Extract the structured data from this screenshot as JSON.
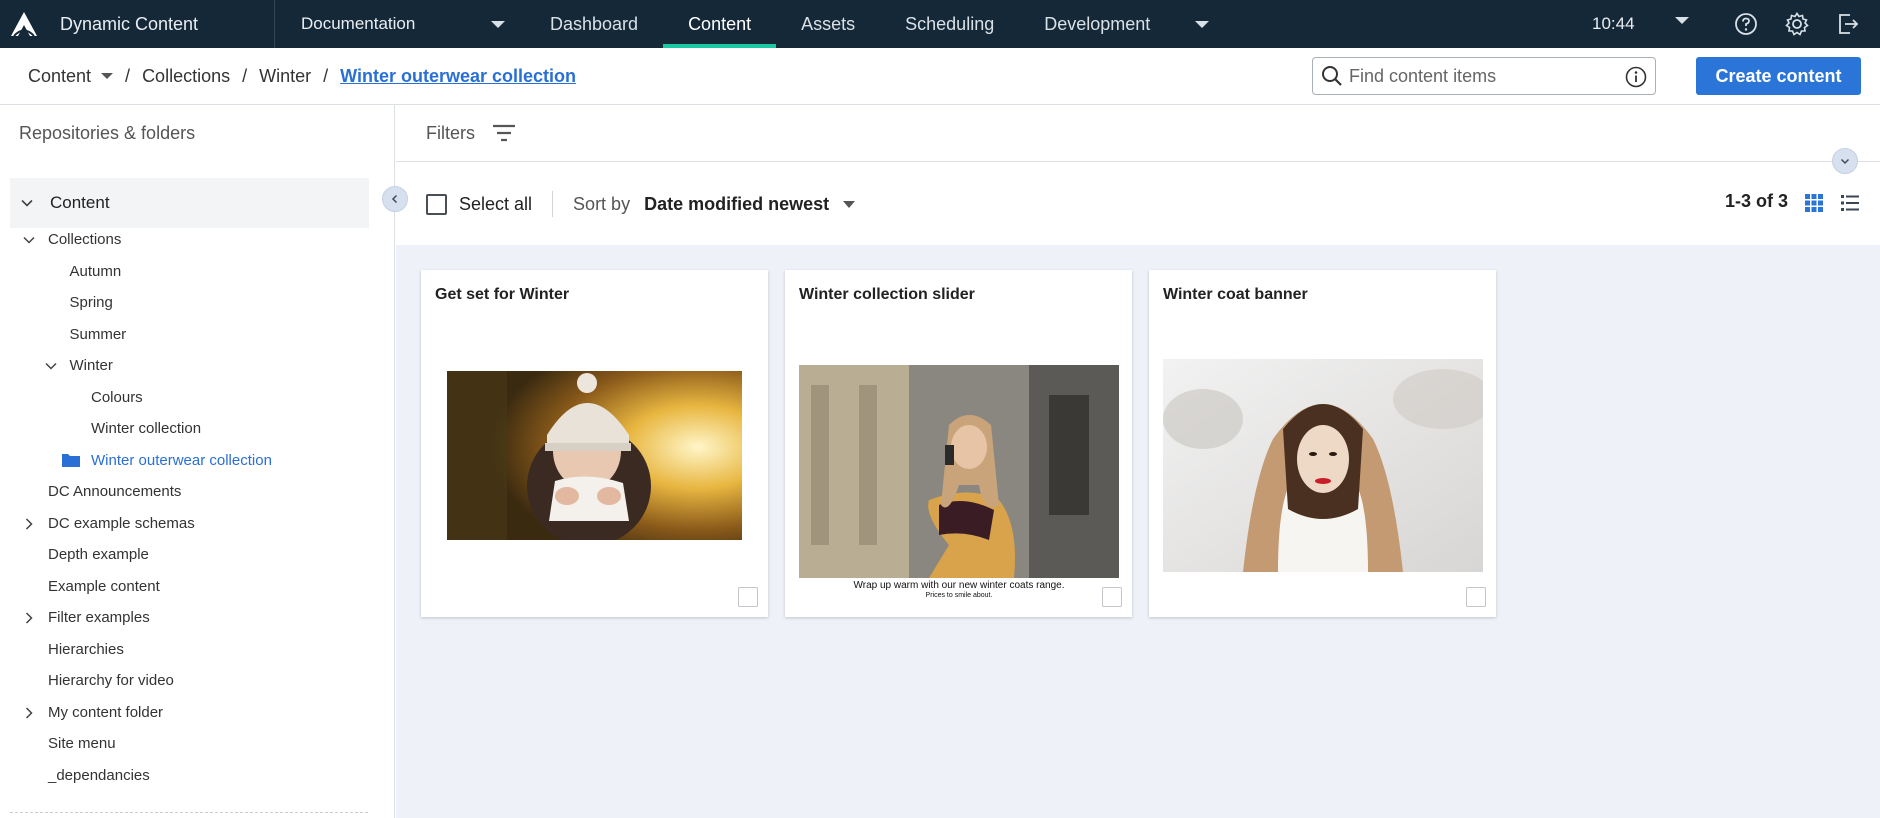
{
  "app": {
    "name": "Dynamic Content",
    "hub": "Documentation",
    "nav_tabs": [
      "Dashboard",
      "Content",
      "Assets",
      "Scheduling",
      "Development"
    ],
    "active_tab": "Content",
    "time": "10:44",
    "icons": [
      "amplience-logo-icon",
      "help-icon",
      "settings-icon",
      "logout-icon"
    ]
  },
  "breadcrumb": {
    "root": "Content",
    "items": [
      "Collections",
      "Winter"
    ],
    "current": "Winter outerwear collection"
  },
  "search": {
    "placeholder": "Find content items",
    "value": ""
  },
  "create_button": "Create content",
  "sidebar": {
    "title": "Repositories & folders",
    "root": "Content",
    "tree": [
      {
        "label": "Collections",
        "depth": 0,
        "chevron": "down"
      },
      {
        "label": "Autumn",
        "depth": 1,
        "chevron": "none"
      },
      {
        "label": "Spring",
        "depth": 1,
        "chevron": "none"
      },
      {
        "label": "Summer",
        "depth": 1,
        "chevron": "none"
      },
      {
        "label": "Winter",
        "depth": 1,
        "chevron": "down"
      },
      {
        "label": "Colours",
        "depth": 2,
        "chevron": "none"
      },
      {
        "label": "Winter collection",
        "depth": 2,
        "chevron": "none"
      },
      {
        "label": "Winter outerwear collection",
        "depth": 2,
        "chevron": "none",
        "selected": true
      },
      {
        "label": "DC Announcements",
        "depth": 0,
        "chevron": "none"
      },
      {
        "label": "DC example schemas",
        "depth": 0,
        "chevron": "right"
      },
      {
        "label": "Depth example",
        "depth": 0,
        "chevron": "none"
      },
      {
        "label": "Example content",
        "depth": 0,
        "chevron": "none"
      },
      {
        "label": "Filter examples",
        "depth": 0,
        "chevron": "right"
      },
      {
        "label": "Hierarchies",
        "depth": 0,
        "chevron": "none"
      },
      {
        "label": "Hierarchy for video",
        "depth": 0,
        "chevron": "none"
      },
      {
        "label": "My content folder",
        "depth": 0,
        "chevron": "right"
      },
      {
        "label": "Site menu",
        "depth": 0,
        "chevron": "none"
      },
      {
        "label": "_dependancies",
        "depth": 0,
        "chevron": "none"
      }
    ]
  },
  "filters": {
    "label": "Filters"
  },
  "toolbar": {
    "select_all": "Select all",
    "sort_by_label": "Sort by",
    "sort_value": "Date modified newest",
    "count": "1-3 of 3"
  },
  "cards": [
    {
      "title": "Get set for Winter"
    },
    {
      "title": "Winter collection slider",
      "caption_line1": "Wrap up warm with our new winter coats range.",
      "caption_line2": "Prices to smile about."
    },
    {
      "title": "Winter coat banner"
    }
  ],
  "colors": {
    "topbar": "#152838",
    "accent_tab": "#1bc7a4",
    "primary": "#2b74d8",
    "link": "#2a6fd6",
    "content_bg": "#eef1f8"
  }
}
